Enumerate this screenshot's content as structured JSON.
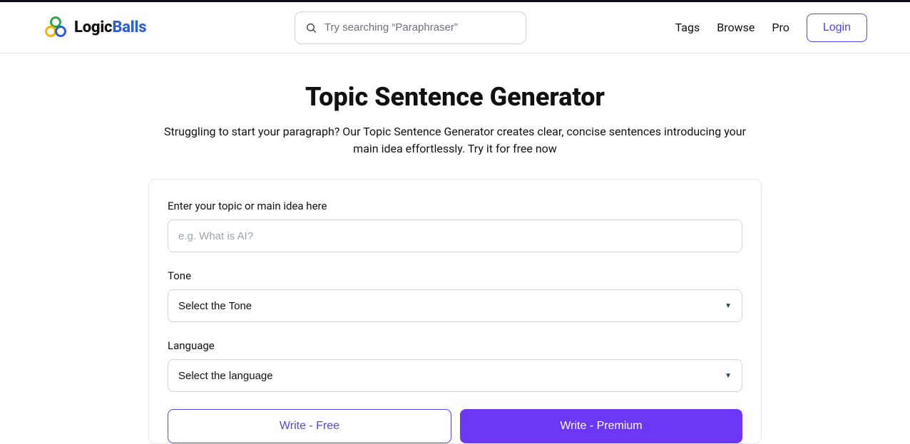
{
  "header": {
    "logo_primary": "Logic",
    "logo_secondary": "Balls",
    "search_placeholder": "Try searching “Paraphraser”",
    "nav": {
      "tags": "Tags",
      "browse": "Browse",
      "pro": "Pro",
      "login": "Login"
    }
  },
  "main": {
    "title": "Topic Sentence Generator",
    "subtitle": "Struggling to start your paragraph? Our Topic Sentence Generator creates clear, concise sentences introducing your main idea effortlessly. Try it for free now"
  },
  "form": {
    "topic_label": "Enter your topic or main idea here",
    "topic_placeholder": "e.g. What is AI?",
    "tone_label": "Tone",
    "tone_selected": "Select the Tone",
    "language_label": "Language",
    "language_selected": "Select the language",
    "write_free_label": "Write - Free",
    "write_premium_label": "Write - Premium"
  }
}
